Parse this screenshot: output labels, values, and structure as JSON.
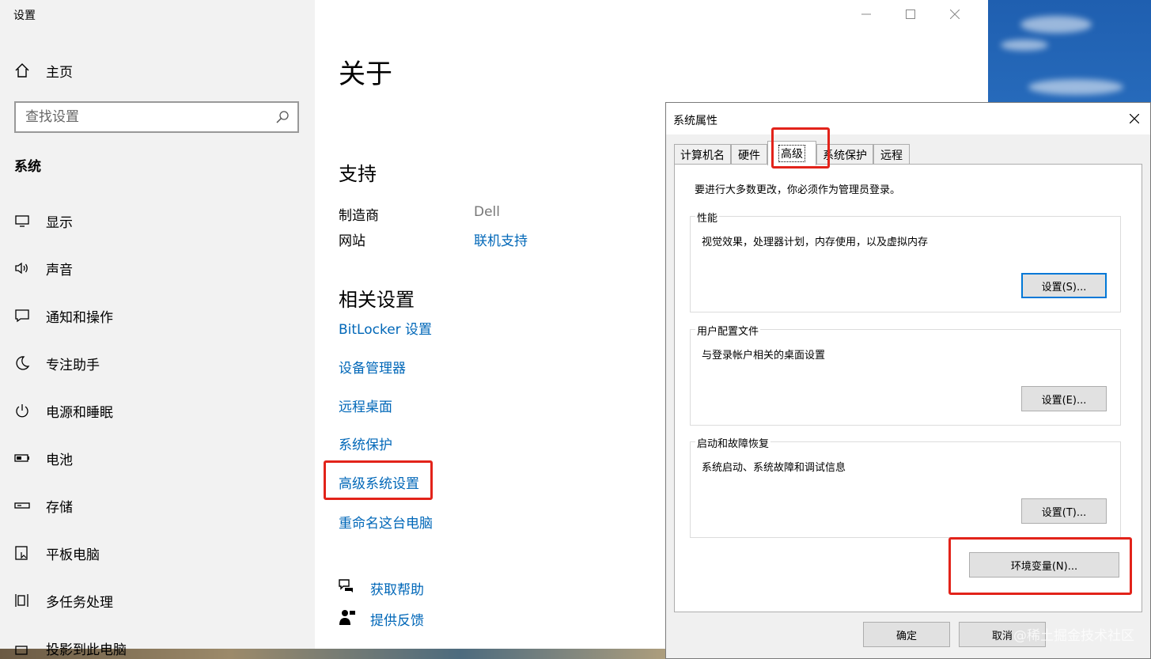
{
  "settings": {
    "app_title": "设置",
    "nav_home": "主页",
    "search_placeholder": "查找设置",
    "section_heading": "系统",
    "nav_items": [
      {
        "label": "显示"
      },
      {
        "label": "声音"
      },
      {
        "label": "通知和操作"
      },
      {
        "label": "专注助手"
      },
      {
        "label": "电源和睡眠"
      },
      {
        "label": "电池"
      },
      {
        "label": "存储"
      },
      {
        "label": "平板电脑"
      },
      {
        "label": "多任务处理"
      },
      {
        "label": "投影到此电脑"
      }
    ],
    "page_title": "关于",
    "support": {
      "heading": "支持",
      "manufacturer_label": "制造商",
      "manufacturer_value": "Dell",
      "website_label": "网站",
      "website_link": "联机支持"
    },
    "related": {
      "heading": "相关设置",
      "links": [
        "BitLocker 设置",
        "设备管理器",
        "远程桌面",
        "系统保护",
        "高级系统设置",
        "重命名这台电脑"
      ]
    },
    "help": {
      "get_help": "获取帮助",
      "feedback": "提供反馈"
    }
  },
  "dialog": {
    "title": "系统属性",
    "tabs": [
      "计算机名",
      "硬件",
      "高级",
      "系统保护",
      "远程"
    ],
    "active_tab": "高级",
    "notice": "要进行大多数更改，你必须作为管理员登录。",
    "groups": [
      {
        "label": "性能",
        "desc": "视觉效果，处理器计划，内存使用，以及虚拟内存",
        "button": "设置(S)..."
      },
      {
        "label": "用户配置文件",
        "desc": "与登录帐户相关的桌面设置",
        "button": "设置(E)..."
      },
      {
        "label": "启动和故障恢复",
        "desc": "系统启动、系统故障和调试信息",
        "button": "设置(T)..."
      }
    ],
    "env_button": "环境变量(N)...",
    "ok_button": "确定",
    "cancel_button": "取消"
  },
  "watermark": "@稀土掘金技术社区",
  "colors": {
    "link": "#0067b8",
    "highlight": "#e2231a",
    "focus": "#0078d7"
  }
}
